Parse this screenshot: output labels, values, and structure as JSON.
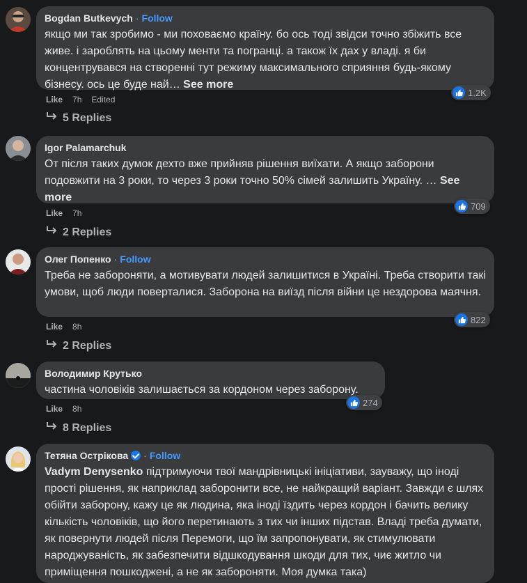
{
  "follow_label": "Follow",
  "see_more_label": "See more",
  "like_label": "Like",
  "comments": [
    {
      "author": "Bogdan Butkevych",
      "text": "якщо ми так зробимо - ми поховаємо країну. бо ось тоді звідси точно збіжить все живе. і зароблять на цьому менти та погранці. а також їх дах у владі. я би концентрувався на створенні тут режиму максимального сприяння будь-якому бізнесу. ось це буде най…",
      "time": "7h",
      "edited": "Edited",
      "reactions": "1.2K",
      "replies": "5 Replies"
    },
    {
      "author": "Igor Palamarchuk",
      "text": "От після таких думок дехто вже прийняв рішення виїхати. А якщо заборони подовжити на 3 роки, то через 3 роки точно 50% сімей залишить Україну. …",
      "time": "7h",
      "reactions": "709",
      "replies": "2 Replies"
    },
    {
      "author": "Олег Попенко",
      "text": "Треба не забороняти, а мотивувати людей залишитися в Україні. Треба створити такі умови, щоб люди поверталися. Заборона на виїзд після війни це нездорова маячня.",
      "time": "8h",
      "reactions": "822",
      "replies": "2 Replies"
    },
    {
      "author": "Володимир Крутько",
      "text": "частина чоловіків залишається за кордоном через заборону.",
      "time": "8h",
      "reactions": "274",
      "replies": "8 Replies"
    },
    {
      "author": "Тетяна Острікова",
      "mention": "Vadym Denysenko",
      "text": "підтримуючи твої мандрівницькі ініціативи, зауважу, що іноді прості рішення, як наприклад заборонити все, не найкращий варіант. Завжди є шлях обійти заборону, кажу це як людина, яка іноді їздить через кордон і бачить велику кількість чоловіків, що його перетинають з тих чи інших підстав. Владі треба думати, як повернути людей після Перемоги, що їм запропонувати, як стимулювати народжуваність, як забезпечити відшкодування шкоди для тих, чиє житло чи приміщення пошкоджені, а не як забороняти. Моя думка така)"
    }
  ]
}
